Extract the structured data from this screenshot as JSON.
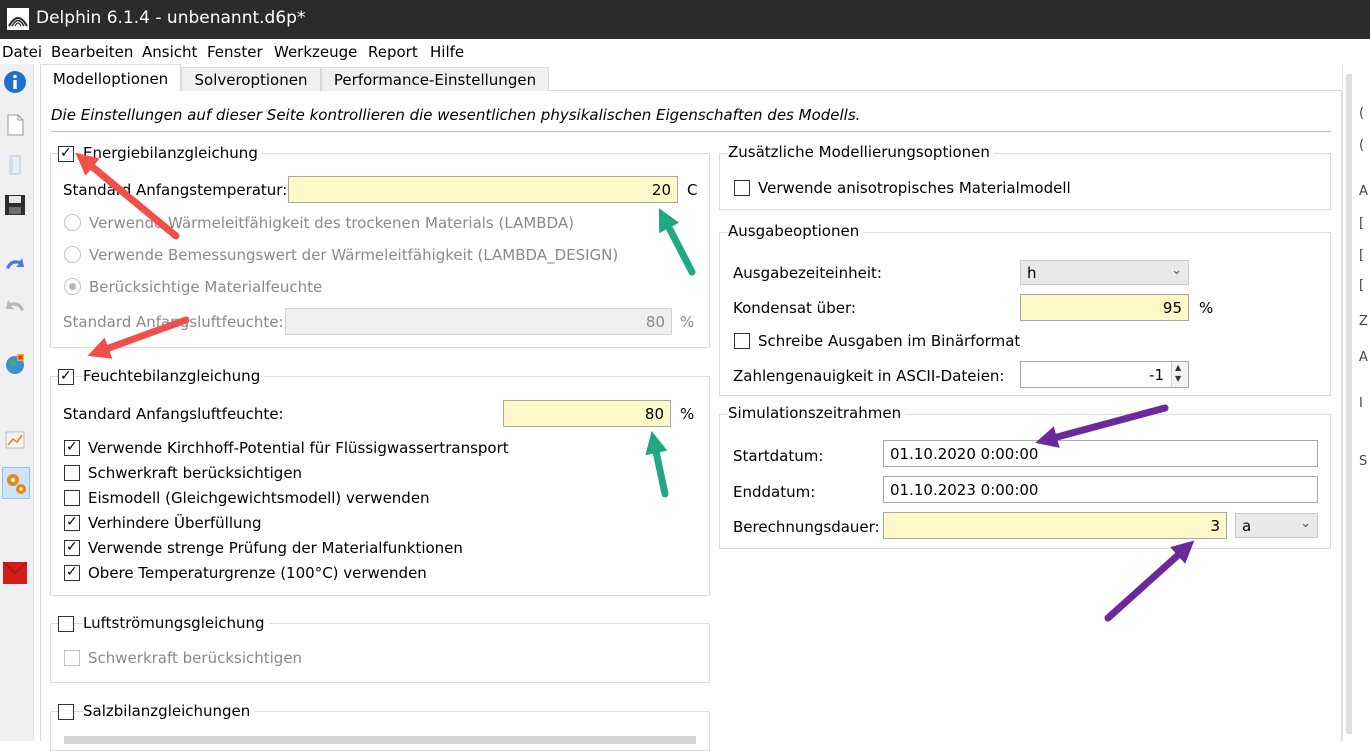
{
  "window": {
    "title": "Delphin 6.1.4 - unbenannt.d6p*"
  },
  "menu": [
    "Datei",
    "Bearbeiten",
    "Ansicht",
    "Fenster",
    "Werkzeuge",
    "Report",
    "Hilfe"
  ],
  "toolbar": {
    "icons": [
      "info-icon",
      "new-file-icon",
      "open-icon",
      "save-icon",
      "undo-icon",
      "redo-icon",
      "globe-icon",
      "chart-icon",
      "settings-gears-icon",
      "red-square-icon"
    ],
    "selected": "settings-gears-icon"
  },
  "tabs": [
    "Modelloptionen",
    "Solveroptionen",
    "Performance-Einstellungen"
  ],
  "active_tab": "Modelloptionen",
  "intro": "Die Einstellungen auf dieser Seite kontrollieren die wesentlichen physikalischen Eigenschaften des Modells.",
  "energy": {
    "title": "Energiebilanzgleichung",
    "checked": true,
    "start_temp_label": "Standard Anfangstemperatur:",
    "start_temp_value": "20",
    "start_temp_unit": "C",
    "radio1": "Verwende Wärmeleitfähigkeit des trockenen Materials (LAMBDA)",
    "radio2": "Verwende Bemessungswert der Wärmeleitfähigkeit (LAMBDA_DESIGN)",
    "radio3": "Berücksichtige Materialfeuchte",
    "rh_label": "Standard Anfangsluftfeuchte:",
    "rh_value": "80",
    "rh_unit": "%"
  },
  "moisture": {
    "title": "Feuchtebilanzgleichung",
    "checked": true,
    "rh_label": "Standard Anfangsluftfeuchte:",
    "rh_value": "80",
    "rh_unit": "%",
    "options": [
      {
        "label": "Verwende Kirchhoff-Potential für Flüssigwassertransport",
        "checked": true
      },
      {
        "label": "Schwerkraft berücksichtigen",
        "checked": false
      },
      {
        "label": "Eismodell (Gleichgewichtsmodell) verwenden",
        "checked": false
      },
      {
        "label": "Verhindere Überfüllung",
        "checked": true
      },
      {
        "label": "Verwende strenge Prüfung der Materialfunktionen",
        "checked": true
      },
      {
        "label": "Obere Temperaturgrenze (100°C) verwenden",
        "checked": true
      }
    ]
  },
  "airflow": {
    "title": "Luftströmungsgleichung",
    "checked": false,
    "gravity": "Schwerkraft berücksichtigen"
  },
  "salt": {
    "title": "Salzbilanzgleichungen",
    "checked": false
  },
  "extra": {
    "title": "Zusätzliche Modellierungsoptionen",
    "anisotropic": "Verwende anisotropisches Materialmodell",
    "anisotropic_checked": false
  },
  "output": {
    "title": "Ausgabeoptionen",
    "time_unit_label": "Ausgabezeiteinheit:",
    "time_unit_value": "h",
    "condensate_label": "Kondensat über:",
    "condensate_value": "95",
    "condensate_unit": "%",
    "binary_label": "Schreibe Ausgaben im Binärformat",
    "binary_checked": false,
    "precision_label": "Zahlengenauigkeit in ASCII-Dateien:",
    "precision_value": "-1"
  },
  "simulation": {
    "title": "Simulationszeitrahmen",
    "start_label": "Startdatum:",
    "start_value": "01.10.2020  0:00:00",
    "end_label": "Enddatum:",
    "end_value": "01.10.2023  0:00:00",
    "duration_label": "Berechnungsdauer:",
    "duration_value": "3",
    "duration_unit": "a"
  },
  "side_panel_glyphs": [
    "(",
    "(",
    "A",
    "[",
    "[",
    "[",
    "Z",
    "A",
    "I",
    "S"
  ],
  "colors": {
    "arrow_red": "#f0504a",
    "arrow_green": "#1fa882",
    "arrow_purple": "#6b2a9b",
    "field_yellow": "#fff8c9"
  }
}
